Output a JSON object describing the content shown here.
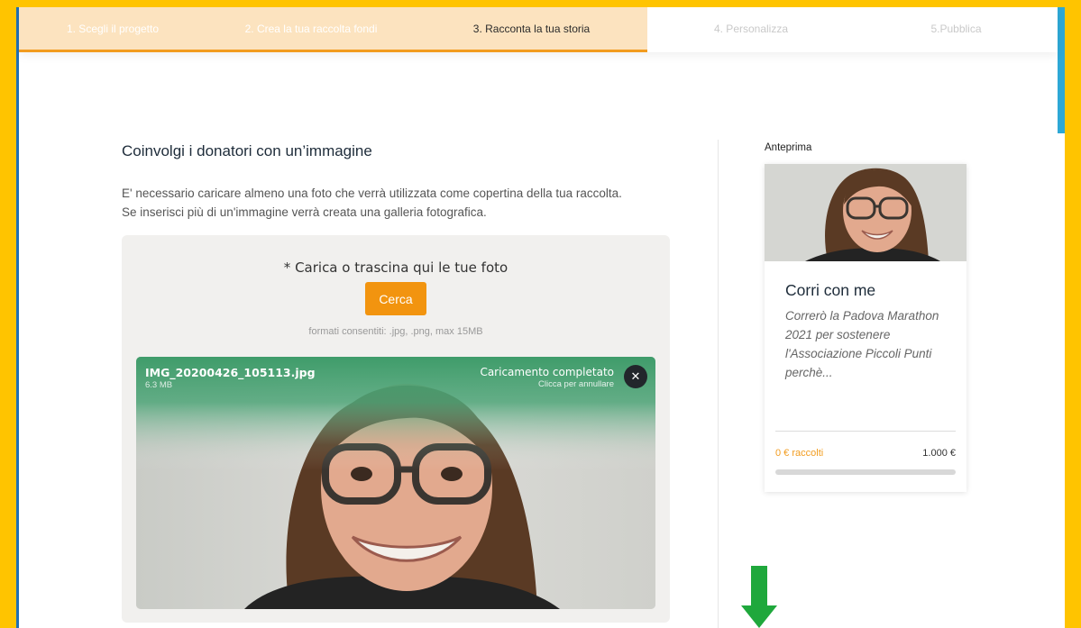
{
  "stepper": {
    "steps": [
      {
        "label": "1. Scegli il progetto",
        "state": "done"
      },
      {
        "label": "2. Crea la tua raccolta fondi",
        "state": "done"
      },
      {
        "label": "3. Racconta la tua storia",
        "state": "current"
      },
      {
        "label": "4. Personalizza",
        "state": "todo"
      },
      {
        "label": "5.Pubblica",
        "state": "todo"
      }
    ]
  },
  "section": {
    "title": "Coinvolgi i donatori con un’immagine",
    "description_line1": "E' necessario caricare almeno una foto che verrà utilizzata come copertina della tua raccolta.",
    "description_line2": "Se inserisci più di un'immagine verrà creata una galleria fotografica."
  },
  "upload": {
    "prompt": "* Carica o trascina qui le tue foto",
    "button_label": "Cerca",
    "formats": "formati consentiti: .jpg, .png, max 15MB",
    "file": {
      "name": "IMG_20200426_105113.jpg",
      "size": "6.3 MB",
      "status": "Caricamento completato",
      "status_hint": "Clicca per annullare",
      "remove_icon": "close-icon"
    }
  },
  "preview": {
    "label": "Anteprima",
    "title": "Corri con me",
    "excerpt": "Correrò la Padova Marathon 2021 per sostenere l'Associazione Piccoli Punti perchè...",
    "raised": "0 € raccolti",
    "goal": "1.000 €",
    "progress_fraction": 0
  },
  "colors": {
    "accent": "#F29C1F",
    "step_done_bg": "#FCE3BF",
    "upload_status_green": "#3F9C6A",
    "frame": "#FFC400",
    "arrow_green": "#1FA83C"
  },
  "icons": {
    "arrow": "arrow-down-icon",
    "close": "close-icon"
  }
}
